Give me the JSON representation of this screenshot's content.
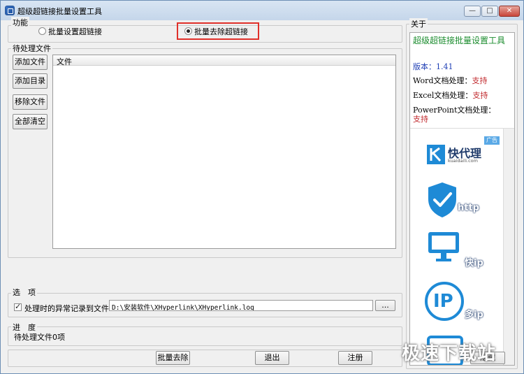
{
  "window": {
    "title": "超级超链接批量设置工具",
    "min_glyph": "—",
    "max_glyph": "□",
    "close_glyph": "✕"
  },
  "function_group": {
    "legend": "功能",
    "option_set_label": "批量设置超链接",
    "option_remove_label": "批量去除超链接",
    "selected": "批量去除超链接"
  },
  "pending_group": {
    "legend": "待处理文件",
    "buttons": [
      "添加文件",
      "添加目录",
      "移除文件",
      "全部清空"
    ],
    "list_header": "文件"
  },
  "options_group": {
    "legend": "选　项",
    "log_checkbox_label": "处理时的异常记录到文件:",
    "log_checked": true,
    "log_path": "D:\\安装软件\\XHyperlink\\XHyperlink.log",
    "browse_label": "..."
  },
  "progress_group": {
    "legend": "进　度",
    "status": "待处理文件0项"
  },
  "bottom_buttons": {
    "remove": "批量去除",
    "exit": "退出",
    "register": "注册"
  },
  "about": {
    "legend": "关于",
    "app_title": "超级超链接批量设置工具",
    "version_label": "版本：",
    "version_value": "1.41",
    "word_label": "Word文档处理：",
    "word_value": "支持",
    "excel_label": "Excel文档处理：",
    "excel_value": "支持",
    "ppt_label": "PowerPoint文档处理：",
    "ppt_value": "支持",
    "ad_badge": "广告",
    "ad_brand": "快代理",
    "ad_domain": "kuaidaili.com",
    "ad_http": "http",
    "ad_fast": "快ip",
    "ad_many": "多ip",
    "ad_ip_text": "IP",
    "hide_button": "隐藏"
  },
  "watermark": "极速下载站",
  "colors": {
    "green": "#1b8c2e",
    "blue": "#1f3fb5",
    "red": "#c0282c",
    "highlight": "#e0302a",
    "ad_blue": "#1e8ad6"
  }
}
